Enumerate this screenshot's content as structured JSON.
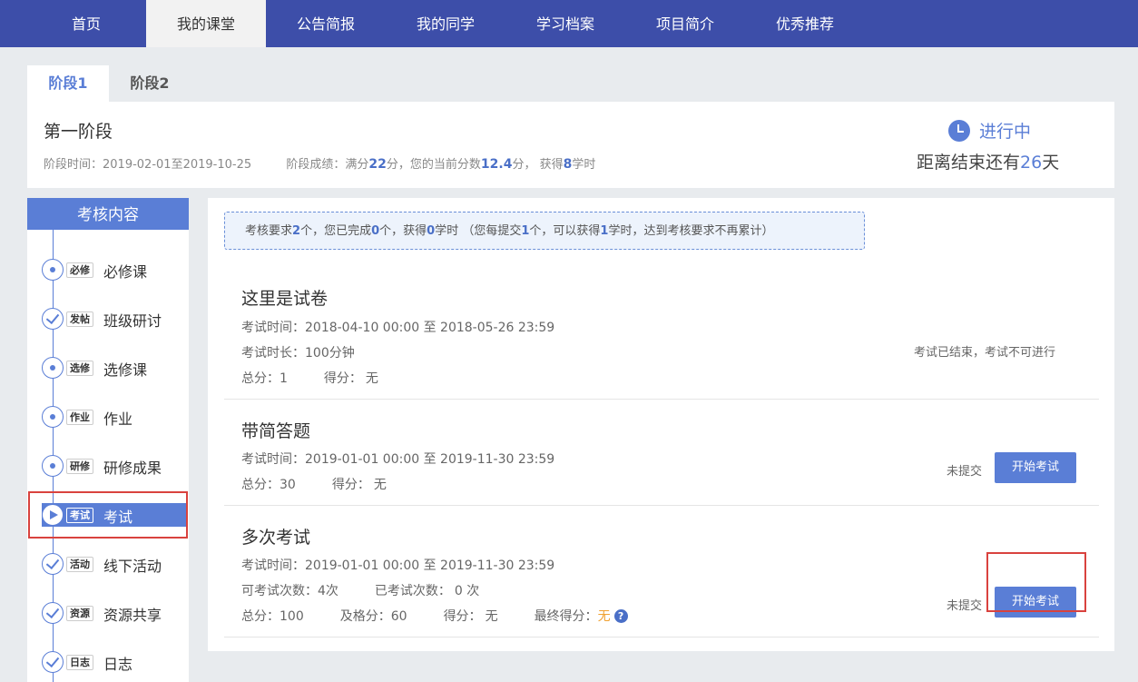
{
  "nav": {
    "items": [
      {
        "label": "首页"
      },
      {
        "label": "我的课堂"
      },
      {
        "label": "公告简报"
      },
      {
        "label": "我的同学"
      },
      {
        "label": "学习档案"
      },
      {
        "label": "项目简介"
      },
      {
        "label": "优秀推荐"
      }
    ],
    "active_index": 1
  },
  "stage_tabs": [
    {
      "label": "阶段1"
    },
    {
      "label": "阶段2"
    }
  ],
  "stage": {
    "title": "第一阶段",
    "time_prefix": "阶段时间：",
    "time_range": "2019-02-01至2019-10-25",
    "score_prefix": "阶段成绩：满分",
    "full_score": "22",
    "score_mid": "分，您的当前分数",
    "current_score": "12.4",
    "score_mid2": "分，  获得",
    "hours": "8",
    "score_suffix": "学时",
    "status": "进行中",
    "remain_prefix": "距离结束还有",
    "remain_days": "26",
    "remain_suffix": "天"
  },
  "sidebar": {
    "title": "考核内容",
    "items": [
      {
        "tag": "必修",
        "label": "必修课",
        "state": "current"
      },
      {
        "tag": "发帖",
        "label": "班级研讨",
        "state": "done"
      },
      {
        "tag": "选修",
        "label": "选修课",
        "state": "current"
      },
      {
        "tag": "作业",
        "label": "作业",
        "state": "current"
      },
      {
        "tag": "研修",
        "label": "研修成果",
        "state": "current"
      },
      {
        "tag": "考试",
        "label": "考试",
        "state": "active"
      },
      {
        "tag": "活动",
        "label": "线下活动",
        "state": "done"
      },
      {
        "tag": "资源",
        "label": "资源共享",
        "state": "done"
      },
      {
        "tag": "日志",
        "label": "日志",
        "state": "done"
      }
    ]
  },
  "notice": {
    "p1": "考核要求",
    "required": "2",
    "p2": "个，您已完成",
    "done": "0",
    "p3": "个，获得",
    "hours": "0",
    "p4": "学时 （您每提交",
    "per": "1",
    "p5": "个，可以获得",
    "per_hours": "1",
    "p6": "学时，达到考核要求不再累计）"
  },
  "exams": [
    {
      "title": "这里是试卷",
      "time_label": "考试时间：",
      "time": "2018-04-10 00:00 至 2018-05-26 23:59",
      "duration_label": "考试时长：",
      "duration": "100分钟",
      "total_label": "总分：",
      "total": "1",
      "got_label": "得分：",
      "got": "无",
      "status": "考试已结束，考试不可进行"
    },
    {
      "title": "带简答题",
      "time_label": "考试时间：",
      "time": "2019-01-01 00:00 至 2019-11-30 23:59",
      "total_label": "总分：",
      "total": "30",
      "got_label": "得分：",
      "got": "无",
      "status": "未提交",
      "button": "开始考试"
    },
    {
      "title": "多次考试",
      "time_label": "考试时间：",
      "time": "2019-01-01 00:00 至 2019-11-30 23:59",
      "attempts_label": "可考试次数：",
      "attempts": "4次",
      "taken_label": "已考试次数：",
      "taken": "0 次",
      "total_label": "总分：",
      "total": "100",
      "pass_label": "及格分：",
      "pass": "60",
      "got_label": "得分：",
      "got": "无",
      "final_label": "最终得分：",
      "final": "无",
      "help": "?",
      "status": "未提交",
      "button": "开始考试"
    }
  ],
  "colors": {
    "nav_bg": "#3d4ea9",
    "accent": "#5a7ed6",
    "highlight": "#d9423e",
    "orange": "#f0a030"
  }
}
